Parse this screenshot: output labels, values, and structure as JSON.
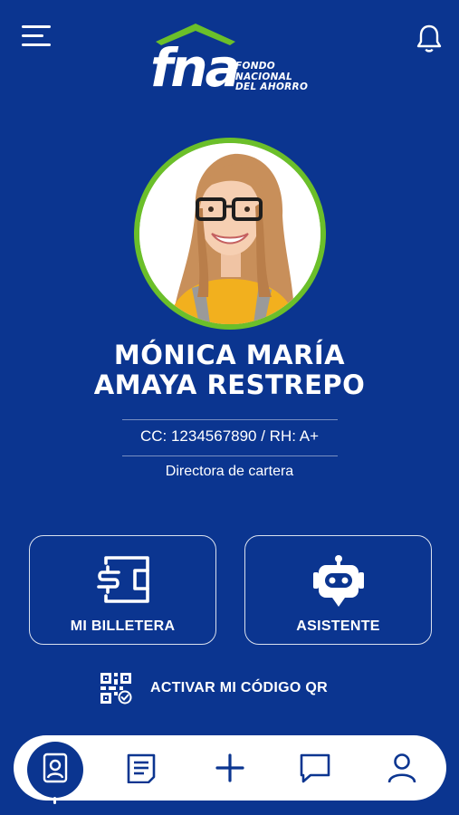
{
  "header": {
    "menu_icon": "hamburger-menu-icon",
    "notifications_icon": "bell-icon",
    "logo": {
      "mark": "fna",
      "words": [
        "FONDO",
        "NACIONAL",
        "DEL AHORRO"
      ],
      "roof_color": "#6bbf2a"
    }
  },
  "profile": {
    "photo": "profile-photo",
    "ring_color": "#6bbf2a",
    "name_line1": "MÓNICA MARÍA",
    "name_line2": "AMAYA RESTREPO",
    "id_text": "CC: 1234567890 / RH: A+",
    "role": "Directora de cartera"
  },
  "actions": {
    "wallet": {
      "label": "MI BILLETERA",
      "icon": "wallet-icon"
    },
    "assistant": {
      "label": "ASISTENTE",
      "icon": "robot-icon"
    },
    "qr": {
      "label": "ACTIVAR MI CÓDIGO QR",
      "icon": "qr-code-icon"
    }
  },
  "bottom_nav": {
    "items": [
      {
        "name": "id-card",
        "icon": "id-card-icon",
        "active": true
      },
      {
        "name": "documents",
        "icon": "document-icon",
        "active": false
      },
      {
        "name": "add",
        "icon": "plus-icon",
        "active": false
      },
      {
        "name": "chat",
        "icon": "chat-icon",
        "active": false
      },
      {
        "name": "profile",
        "icon": "user-icon",
        "active": false
      }
    ]
  },
  "colors": {
    "background": "#0b3590",
    "accent_green": "#6bbf2a",
    "nav_background": "#ffffff"
  }
}
